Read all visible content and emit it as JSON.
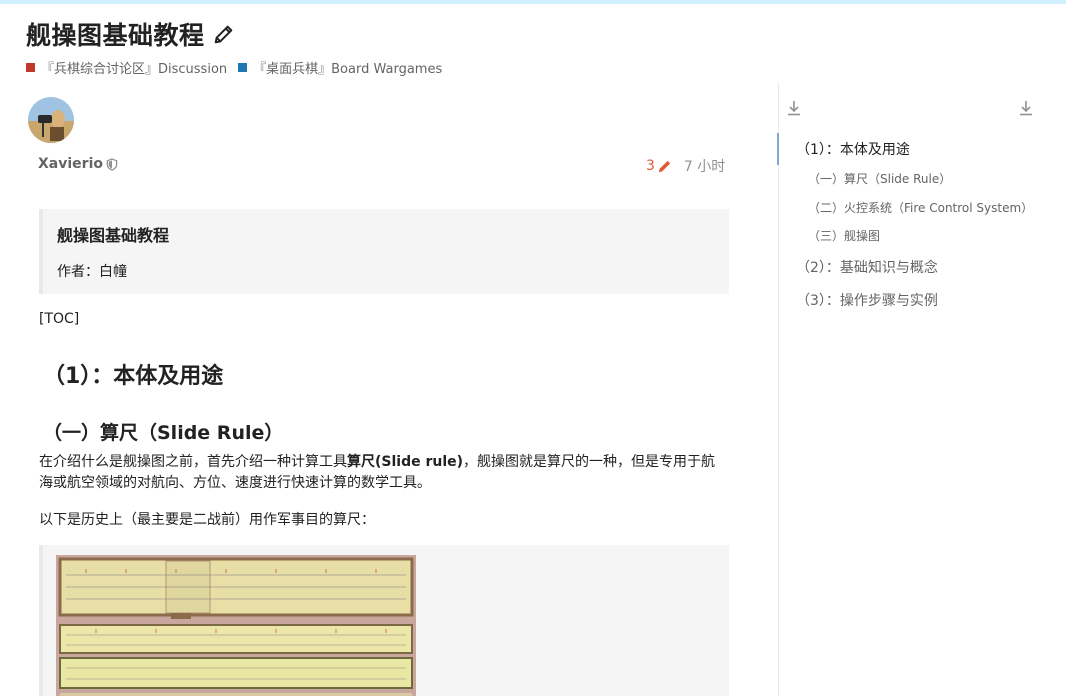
{
  "topic": {
    "title": "舰操图基础教程",
    "categories": [
      {
        "label": "『兵棋综合讨论区』Discussion",
        "color": "#c0392b"
      },
      {
        "label": "『桌面兵棋』Board Wargames",
        "color": "#1f78b4"
      }
    ]
  },
  "post": {
    "username": "Xavierio",
    "edit_count": "3",
    "time": "7 小时",
    "quote_title": "舰操图基础教程",
    "quote_author": "作者：白幢",
    "toc_tag": "[TOC]",
    "heading1": "（1）：本体及用途",
    "heading2": "（一）算尺（Slide Rule）",
    "para1_a": "在介绍什么是舰操图之前，首先介绍一种计算工具",
    "para1_bold": "算尺(Slide rule)",
    "para1_b": "，舰操图就是算尺的一种，但是专用于航海或航空领域的对航向、方位、速度进行快速计算的数学工具。",
    "para2": "以下是历史上（最主要是二战前）用作军事目的算尺："
  },
  "toc": {
    "items": [
      {
        "label": "（1）：本体及用途",
        "level": 1,
        "active": true
      },
      {
        "label": "（一）算尺（Slide Rule）",
        "level": 2
      },
      {
        "label": "（二）火控系统（Fire Control System）",
        "level": 2
      },
      {
        "label": "（三）舰操图",
        "level": 2
      },
      {
        "label": "（2）：基础知识与概念",
        "level": 1
      },
      {
        "label": "（3）：操作步骤与实例",
        "level": 1
      }
    ]
  },
  "colors": {
    "accent_orange": "#e45735",
    "top_bar": "#d1f0ff",
    "toc_active": "#7fa8d3"
  },
  "icons": {
    "edit": "pencil-icon",
    "shield": "shield-icon",
    "download": "download-icon"
  }
}
